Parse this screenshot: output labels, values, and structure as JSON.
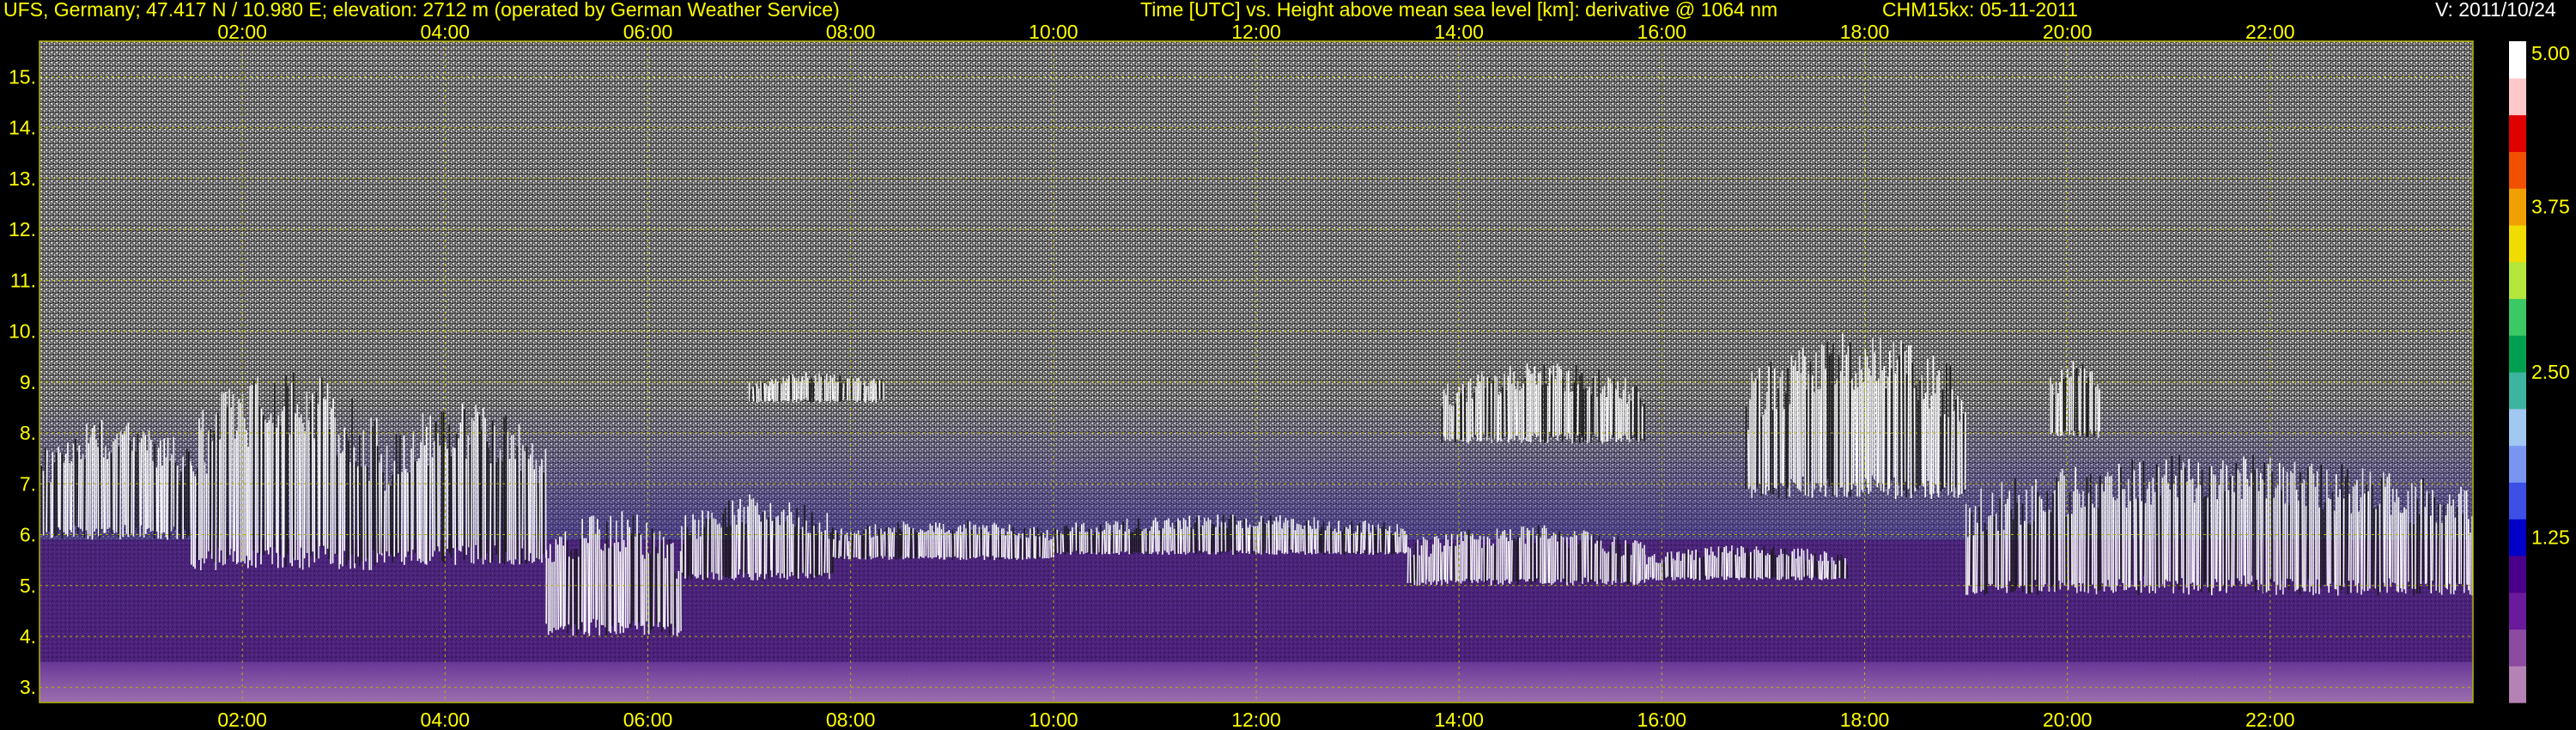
{
  "header": {
    "station": "UFS, Germany; 47.417 N / 10.980 E; elevation: 2712 m  (operated by German Weather Service)",
    "description": "Time [UTC] vs. Height above mean sea level [km]: derivative @ 1064 nm",
    "instrument_date": "CHM15kx: 05-11-2011",
    "version": "V: 2011/10/24"
  },
  "colors": {
    "background": "#000000",
    "axis_text": "#ffff00",
    "gridline": "#b4b400",
    "header_white": "#ffffff"
  },
  "chart_data": {
    "type": "heatmap",
    "x_unit": "UTC time",
    "xlim": [
      "00:00",
      "24:00"
    ],
    "x_ticks": [
      "02:00",
      "04:00",
      "06:00",
      "08:00",
      "10:00",
      "12:00",
      "14:00",
      "16:00",
      "18:00",
      "20:00",
      "22:00"
    ],
    "y_unit": "km",
    "ylim": [
      2.7,
      15.7
    ],
    "y_ticks": [
      "3.",
      "4.",
      "5.",
      "6.",
      "7.",
      "8.",
      "9.",
      "10.",
      "11.",
      "12.",
      "13.",
      "14.",
      "15."
    ],
    "colorbar": {
      "ticks": [
        "1.25",
        "2.50",
        "3.75",
        "5.00"
      ],
      "range": [
        0,
        5.0
      ],
      "colors": [
        "#b482b4",
        "#8c4aa0",
        "#6a1a9a",
        "#4a0088",
        "#0000c8",
        "#3c50e6",
        "#7896f0",
        "#a0c8f0",
        "#3cb4a0",
        "#00a050",
        "#3cc864",
        "#b4e63c",
        "#f0dc00",
        "#f0a000",
        "#f05000",
        "#e00000",
        "#ffc8c8",
        "#ffffff"
      ]
    },
    "cloud_layers": [
      {
        "start": "00:00",
        "end": "01:30",
        "base_km": 5.9,
        "top_km": 8.3
      },
      {
        "start": "01:30",
        "end": "03:20",
        "base_km": 5.3,
        "top_km": 9.3
      },
      {
        "start": "03:20",
        "end": "05:00",
        "base_km": 5.4,
        "top_km": 8.6
      },
      {
        "start": "05:00",
        "end": "06:20",
        "base_km": 4.0,
        "top_km": 6.5
      },
      {
        "start": "06:20",
        "end": "07:50",
        "base_km": 5.1,
        "top_km": 6.8
      },
      {
        "start": "07:00",
        "end": "08:20",
        "base_km": 8.6,
        "top_km": 9.2
      },
      {
        "start": "07:50",
        "end": "10:00",
        "base_km": 5.5,
        "top_km": 6.3
      },
      {
        "start": "10:00",
        "end": "13:30",
        "base_km": 5.6,
        "top_km": 6.4
      },
      {
        "start": "13:30",
        "end": "15:50",
        "base_km": 5.0,
        "top_km": 6.2
      },
      {
        "start": "13:50",
        "end": "15:50",
        "base_km": 7.8,
        "top_km": 9.4
      },
      {
        "start": "15:50",
        "end": "17:50",
        "base_km": 5.1,
        "top_km": 5.8
      },
      {
        "start": "16:50",
        "end": "19:00",
        "base_km": 6.7,
        "top_km": 10.0
      },
      {
        "start": "19:50",
        "end": "20:20",
        "base_km": 7.9,
        "top_km": 9.5
      },
      {
        "start": "19:00",
        "end": "24:00",
        "base_km": 4.8,
        "top_km": 7.6
      }
    ]
  }
}
